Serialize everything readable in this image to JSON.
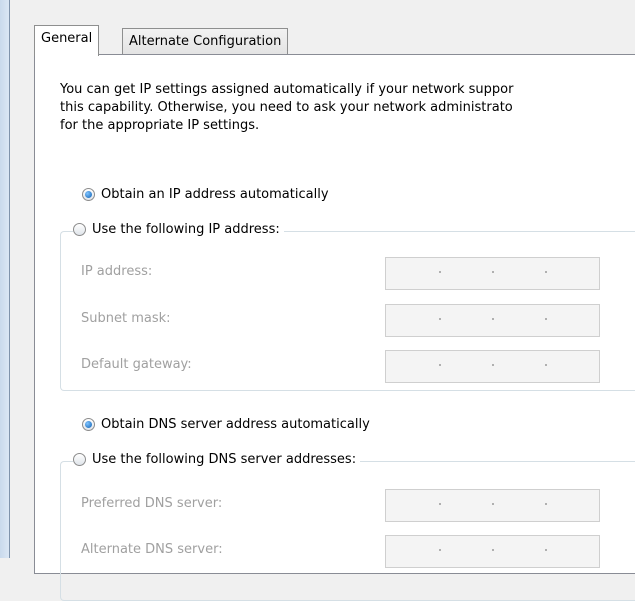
{
  "tabs": {
    "general": "General",
    "alternate": "Alternate Configuration"
  },
  "description": {
    "line1": "You can get IP settings assigned automatically if your network suppor",
    "line2": "this capability. Otherwise, you need to ask your network administrato",
    "line3": "for the appropriate IP settings."
  },
  "ip": {
    "auto_label": "Obtain an IP address automatically",
    "manual_label": "Use the following IP address:",
    "selected": "auto",
    "fields": {
      "ip_address": "IP address:",
      "subnet_mask": "Subnet mask:",
      "default_gateway": "Default gateway:"
    }
  },
  "dns": {
    "auto_label": "Obtain DNS server address automatically",
    "manual_label": "Use the following DNS server addresses:",
    "selected": "auto",
    "fields": {
      "preferred": "Preferred DNS server:",
      "alternate": "Alternate DNS server:"
    }
  },
  "colors": {
    "radio_selected": "#1c74d2",
    "disabled_text": "#a0a0a0",
    "disabled_field": "#f4f4f4"
  }
}
